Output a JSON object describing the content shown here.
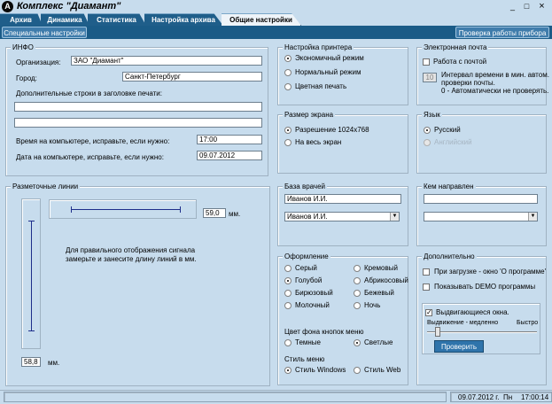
{
  "window": {
    "title": "Комплекс \"Диамант\"",
    "logo": "А",
    "controls": [
      "_",
      "□",
      "×"
    ]
  },
  "tabs": [
    {
      "label": "Архив"
    },
    {
      "label": "Динамика"
    },
    {
      "label": "Статистика"
    },
    {
      "label": "Настройка архива"
    },
    {
      "label": "Общие настройки"
    }
  ],
  "toolbar": {
    "special_settings": "Специальные настройки",
    "device_check": "Проверка работы прибора"
  },
  "info": {
    "title": "ИНФО",
    "org_label": "Организация:",
    "org_value": "ЗАО \"Диамант\"",
    "city_label": "Город:",
    "city_value": "Санкт-Петербург",
    "extra_lines_label": "Дополнительные строки в заголовке печати:",
    "extra_line_1": "",
    "extra_line_2": "",
    "time_label": "Время на компьютере, исправьте, если нужно:",
    "time_value": "17:00",
    "date_label": "Дата на компьютере, исправьте, если нужно:",
    "date_value": "09.07.2012"
  },
  "printer": {
    "title": "Настройка принтера",
    "options": [
      "Экономичный режим",
      "Нормальный режим",
      "Цветная печать"
    ],
    "selected": 0
  },
  "email": {
    "title": "Электронная почта",
    "work_label": "Работа с почтой",
    "interval_value": "10",
    "interval_text_1": "Интервал времени в мин. автом.",
    "interval_text_2": "проверки почты.",
    "interval_text_3": "0 - Автоматически не проверять."
  },
  "screen": {
    "title": "Размер экрана",
    "options": [
      "Разрешение 1024x768",
      "На весь экран"
    ],
    "selected": 0
  },
  "language": {
    "title": "Язык",
    "options": [
      "Русский",
      "Английский"
    ],
    "selected": 0
  },
  "marking": {
    "title": "Разметочные линии",
    "horizontal_value": "59,0",
    "vertical_value": "58,8",
    "unit": "мм.",
    "instructions": "Для правильного отображения сигнала замерьте и занесите длину линий в мм."
  },
  "doctors": {
    "title": "База врачей",
    "input_value": "Иванов И.И.",
    "select_value": "Иванов И.И."
  },
  "referrer": {
    "title": "Кем направлен",
    "input_value": "",
    "select_value": ""
  },
  "design": {
    "title": "Оформление",
    "colors_left": [
      "Серый",
      "Голубой",
      "Бирюзовый",
      "Молочный"
    ],
    "colors_right": [
      "Кремовый",
      "Абрикосовый",
      "Бежевый",
      "Ночь"
    ],
    "selected_color": "Голубой",
    "btn_bg_title": "Цвет фона кнопок меню",
    "btn_bg_options": [
      "Темные",
      "Светлые"
    ],
    "btn_bg_selected": 1,
    "menu_style_title": "Стиль меню",
    "menu_style_options": [
      "Стиль Windows",
      "Стиль Web"
    ],
    "menu_style_selected": 0
  },
  "additional": {
    "title": "Дополнительно",
    "startup_label": "При загрузке - окно 'О программе'",
    "demo_label": "Показывать DEMO программы",
    "slide_label": "Выдвигающиеся окна.",
    "slide_checked": true,
    "slow_label": "Выдвижение - медленно",
    "fast_label": "Быстро",
    "slider_fraction": 0.08,
    "check_button": "Проверить"
  },
  "status": {
    "date": "09.07.2012 г.",
    "day": "Пн",
    "time": "17:00:14"
  },
  "colors": {
    "background": "#c7dced",
    "tab_blue": "#1f5e8a",
    "strip_blue": "#1a5b87",
    "button_blue": "#3f7cab"
  }
}
